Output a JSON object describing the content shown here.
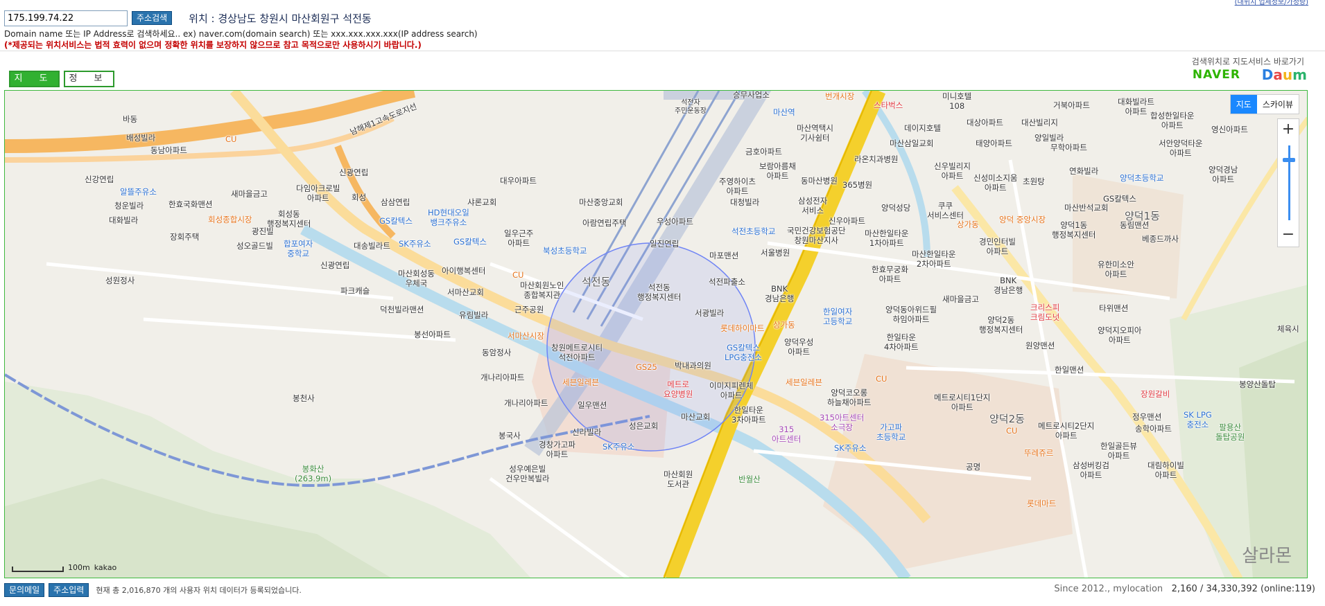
{
  "header": {
    "ip_value": "175.199.74.22",
    "search_button": "주소검색",
    "location": "위치 : 경상남도 창원시 마산회원구 석전동",
    "hint": "Domain name 또는 IP Address로 검색하세요.. ex) naver.com(domain search) 또는 xxx.xxx.xxx.xxx(IP address search)",
    "warning": "(*제공되는 위치서비스는 법적 효력이 없으며 정확한 위치를 보장하지 않으므로 참고 목적으로만 사용하시기 바랍니다.)",
    "top_link": "(내위치 업체정보/가정량)"
  },
  "tabs": {
    "map": "지 도",
    "info": "정 보"
  },
  "services": {
    "label": "검색위치로 지도서비스 바로가기",
    "naver": "NAVER",
    "daum": "Daum"
  },
  "map": {
    "view_map": "지도",
    "view_sky": "스카이뷰",
    "zoom_in": "+",
    "zoom_out": "−",
    "zoom_level": 0.82,
    "scale": "100m",
    "brand": "kakao",
    "watermark": "살라몬",
    "labels": {
      "l1": "바동",
      "l2": "배성빌라",
      "l3": "동남아파트",
      "l4": "CU",
      "l5": "남해제1고속도로지선",
      "l6": "신강연립",
      "l7": "알뜰주유소",
      "l8": "새마을금고",
      "l9": "한효국화맨션",
      "l10": "다임아크로빌\n아파트",
      "l11": "회성",
      "l12": "신광연립",
      "l13": "청운빌라",
      "l14": "회성동\n행정복지센터",
      "l15": "회성종합시장",
      "l16": "대화빌라",
      "l17": "광진빌",
      "l18": "장회주택",
      "l19": "합포여자\n중학교",
      "l20": "성오골드빌",
      "l21": "성원정사",
      "l22": "신광연립",
      "l23": "마산회성동\n우체국",
      "l24": "아이행복센터",
      "l25": "파크캐슬",
      "l26": "덕천빌라맨션",
      "l27": "서마산교회",
      "l28": "유림빌라",
      "l29": "봉선아파트",
      "l30": "서마산시장",
      "l31": "동암정사",
      "l32": "개나리아파트",
      "l33": "개나리아파트",
      "l34": "봉국사",
      "l35": "봉천사",
      "l36": "봉화산\n(263.9m)",
      "l37": "삼삼연립",
      "l38": "HD현대오일\n뱅크주유소",
      "l39": "GS칼텍스",
      "l40": "SK주유소",
      "l41": "GS칼텍스",
      "l42": "대송빌라트",
      "l43": "대우아파트",
      "l44": "샤론교회",
      "l45": "일우근주\n아파트",
      "l46": "마산중앙교회",
      "l47": "북성초등학교",
      "l48": "CU",
      "l49": "마산회원노인\n종합복지관",
      "l50": "근주공원",
      "l51": "아람연립주택",
      "l52": "우성아파트",
      "l53": "일진연립",
      "l54": "마포맨션",
      "l55": "석전동",
      "l56": "석전동\n행정복지센터",
      "l57": "석전파출소",
      "l58": "서광빌라",
      "l59": "창원메트로시티\n석전아파트",
      "l60": "GS25",
      "l61": "박내과의원",
      "l62": "GS칼텍스\nLPG충전소",
      "l63": "세븐일레븐",
      "l64": "메트로\n요양병원",
      "l65": "이미지피렌체\n아파트",
      "l66": "일우맨션",
      "l67": "신라빌라",
      "l68": "성은교회",
      "l69": "경창가고파\n아파트",
      "l70": "SK주유소",
      "l71": "성우예은빌\n건우만복빌라",
      "l72": "마산교회",
      "l73": "한일타운\n3차아파트",
      "l74": "마산회원\n도서관",
      "l75": "반월산",
      "l76": "마산역",
      "l77": "마산역택시\n기사쉼터",
      "l78": "번개시장",
      "l79": "스타벅스",
      "l80": "미니호텔\n108",
      "l81": "데이지호텔",
      "l82": "마산삼일교회",
      "l83": "대상아파트",
      "l84": "대산빌리지",
      "l85": "태양아파트",
      "l86": "양일빌라",
      "l87": "무학아파트",
      "l88": "거북아파트",
      "l89": "대화빌라트\n아파트",
      "l90": "합성한일타운\n아파트",
      "l91": "영신아파트",
      "l92": "서안양덕타운\n아파트",
      "l93": "양덕경남\n아파트",
      "l94": "금호아파트",
      "l95": "보람아름채\n아파트",
      "l96": "주영하이츠\n아파트",
      "l97": "대청빌라",
      "l98": "동마산병원",
      "l99": "365병원",
      "l100": "라온치과병원",
      "l101": "신우빌리지\n아파트",
      "l102": "신성미소지움\n아파트",
      "l103": "초원탕",
      "l104": "연화빌라",
      "l105": "양덕초등학교",
      "l106": "삼성전자\n서비스",
      "l107": "신우아파트",
      "l108": "양덕성당",
      "l109": "쿠쿠\n서비스센터",
      "l110": "상가동",
      "l111": "양덕 중앙시장",
      "l112": "마산반석교회",
      "l113": "GS칼텍스",
      "l114": "양덕1동\n행정복지센터",
      "l115": "양덕1동",
      "l116": "동림맨션",
      "l117": "베종드까사",
      "l118": "석전초등학교",
      "l119": "국민건강보험공단\n창원마산지사",
      "l120": "마산한일타운\n1차아파트",
      "l121": "마산한일타운\n2차아파트",
      "l122": "경민인터빌\n아파트",
      "l123": "서울병원",
      "l124": "유한미소안\n아파트",
      "l125": "한효무궁화\n아파트",
      "l126": "BNK\n경남은행",
      "l127": "BNK\n경남은행",
      "l128": "새마을금고",
      "l129": "한일여자\n고등학교",
      "l130": "양덕동아위드필\n하임아파트",
      "l131": "크리스피\n크림도넛",
      "l132": "타위맨션",
      "l133": "양덕2동\n행정복지센터",
      "l134": "양덕지오피아\n아파트",
      "l135": "롯데하이마트",
      "l136": "상가동",
      "l137": "양덕우성\n아파트",
      "l138": "한일타운\n4차아파트",
      "l139": "원양맨션",
      "l140": "체육시",
      "l141": "세븐일레븐",
      "l142": "CU",
      "l143": "양덕코오롱\n하늘채아파트",
      "l144": "한일맨션",
      "l145": "메트로시티1단지\n아파트",
      "l146": "장원갈비",
      "l147": "봉양산돌탑",
      "l148": "정우맨션",
      "l149": "송학아파트",
      "l150": "SK LPG\n충전소",
      "l151": "팔용산\n돌탑공원",
      "l152": "315\n아트센터",
      "l153": "315아트센터\n소극장",
      "l154": "가고파\n초등학교",
      "l155": "SK주유소",
      "l156": "양덕2동",
      "l157": "CU",
      "l158": "메트로시티2단지\n아파트",
      "l159": "한일골든뷰\n아파트",
      "l160": "뚜레쥬르",
      "l161": "공명",
      "l162": "삼성버킹검\n아파트",
      "l163": "대림하이빌\n아파트",
      "l164": "롯데마트",
      "l165": "석전자\n주민운동장",
      "l166": "승무사업소"
    }
  },
  "footer": {
    "mail_button": "문의메일",
    "addr_button": "주소입력",
    "count_text": "현재 총 2,016,870 개의 사용자 위치 데이터가 등록되었습니다.",
    "since": "Since 2012., mylocation",
    "stats": "2,160 / 34,330,392 (online:119)"
  }
}
